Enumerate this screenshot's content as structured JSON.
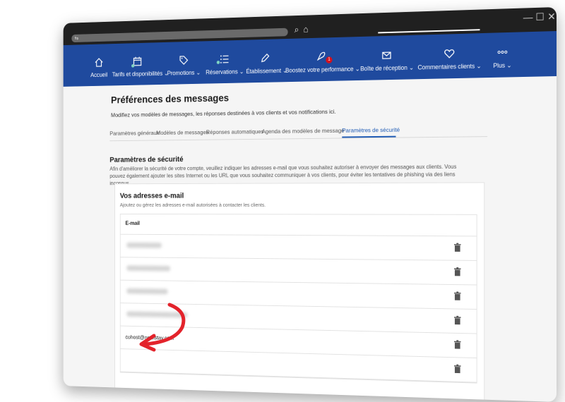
{
  "nav": {
    "items": [
      {
        "label": "Accueil"
      },
      {
        "label": "Tarifs et disponibilités ⌄"
      },
      {
        "label": "Promotions ⌄"
      },
      {
        "label": "Réservations ⌄"
      },
      {
        "label": "Établissement ⌄"
      },
      {
        "label": "Boostez votre performance ⌄",
        "badge": "1"
      },
      {
        "label": "Boîte de réception ⌄"
      },
      {
        "label": "Commentaires clients ⌄"
      },
      {
        "label": "Plus ⌄"
      }
    ]
  },
  "page": {
    "title": "Préférences des messages",
    "subtitle": "Modifiez vos modèles de messages, les réponses destinées à vos clients et vos notifications ici.",
    "tabs": [
      {
        "label": "Paramètres généraux"
      },
      {
        "label": "Modèles de messages"
      },
      {
        "label": "Réponses automatiques"
      },
      {
        "label": "Agenda des modèles de message"
      },
      {
        "label": "Paramètres de sécurité",
        "active": true
      }
    ]
  },
  "security": {
    "title": "Paramètres de sécurité",
    "description": "Afin d'améliorer la sécurité de votre compte, veuillez indiquer les adresses e-mail que vous souhaitez autoriser à envoyer des messages aux clients. Vous pouvez également ajouter les sites Internet ou les URL que vous souhaitez communiquer à vos clients, pour éviter les tentatives de phishing via des liens inconnus."
  },
  "emails": {
    "title": "Vos adresses e-mail",
    "subtitle": "Ajoutez ou gérez les adresses e-mail autorisées à contacter les clients.",
    "column_header": "E-mail",
    "visible_email": "cohost@nowistay.com"
  },
  "colors": {
    "nav_bg": "#1f4a9e",
    "active_tab": "#1f5bb5",
    "arrow": "#e3232b"
  }
}
